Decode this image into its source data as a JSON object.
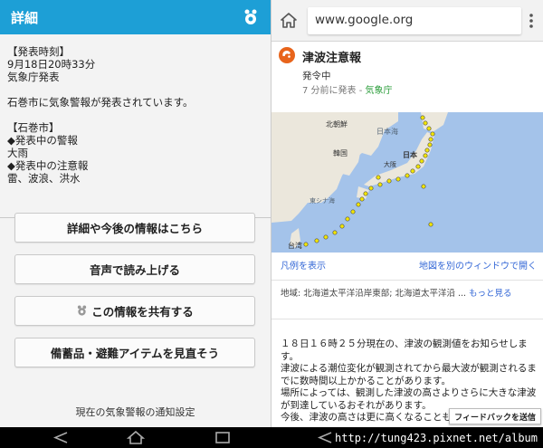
{
  "left": {
    "title": "詳細",
    "report_time_header": "【発表時刻】",
    "report_time": "9月18日20時33分",
    "issuer": "気象庁発表",
    "summary": "石巻市に気象警報が発表されています。",
    "city_header": "【石巻市】",
    "warnings_header": "◆発表中の警報",
    "warnings": "大雨",
    "advisories_header": "◆発表中の注意報",
    "advisories": "雷、波浪、洪水",
    "buttons": {
      "details": "詳細や今後の情報はこちら",
      "read_aloud": "音声で読み上げる",
      "share": "この情報を共有する",
      "supplies": "備蓄品・避難アイテムを見直そう"
    },
    "notify_label": "現在の気象警報の通知設定"
  },
  "right": {
    "url": "www.google.org",
    "alert_title": "津波注意報",
    "alert_status": "発令中",
    "alert_time": "7 分前に発表 - ",
    "alert_source": "気象庁",
    "map_labels": {
      "north_korea": "北朝鮮",
      "korea": "韓国",
      "sea_of_japan": "日本海",
      "japan": "日本",
      "osaka": "大阪",
      "east_china_sea": "東シナ海",
      "taiwan": "台湾"
    },
    "legend_link": "凡例を表示",
    "map_window_link": "地図を別のウィンドウで開く",
    "region_text": "地域: 北海道太平洋沿岸東部; 北海道太平洋沿 ... ",
    "region_more": "もっと見る",
    "bulletin": [
      "１８日１６時２５分現在の、津波の観測値をお知らせします。",
      "津波による潮位変化が観測されてから最大波が観測されるまでに数時間以上かかることがあります。",
      "場所によっては、観測した津波の高さよりさらに大きな津波が到達しているおそれがあります。",
      "今後、津波の高さは更に高くなることも"
    ],
    "feedback": "フィードバックを送信"
  },
  "watermark": "http://tung423.pixnet.net/album",
  "colors": {
    "header_blue": "#1d9fd6",
    "link_blue": "#3367d6",
    "source_green": "#2a9d3a",
    "alert_orange": "#e8641b",
    "tsunami_yellow": "#f3e600"
  }
}
